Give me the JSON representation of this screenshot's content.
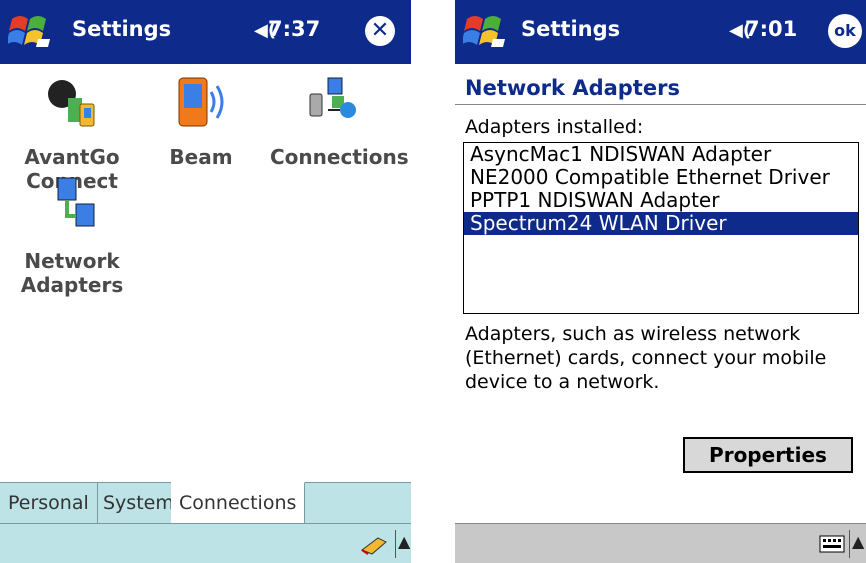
{
  "left": {
    "title": "Settings",
    "time": "7:37",
    "tiles": [
      {
        "label_l1": "AvantGo",
        "label_l2": "Connect"
      },
      {
        "label_l1": "Beam",
        "label_l2": ""
      },
      {
        "label_l1": "Connections",
        "label_l2": ""
      },
      {
        "label_l1": "Network",
        "label_l2": "Adapters"
      }
    ],
    "tabs": [
      "Personal",
      "System",
      "Connections"
    ],
    "active_tab": "Connections"
  },
  "right": {
    "title": "Settings",
    "time": "7:01",
    "ok_label": "ok",
    "page_title": "Network Adapters",
    "list_label": "Adapters installed:",
    "adapters": [
      "AsyncMac1 NDISWAN Adapter",
      "NE2000 Compatible Ethernet Driver",
      "PPTP1 NDISWAN Adapter",
      "Spectrum24 WLAN Driver"
    ],
    "selected_adapter": "Spectrum24 WLAN Driver",
    "description": "Adapters, such as wireless network (Ethernet) cards, connect your mobile device to a network.",
    "properties_label": "Properties"
  },
  "colors": {
    "titlebar": "#0e2a8a",
    "tabbar": "#bde3e6",
    "icon_label": "#4a4a4a"
  },
  "icons": [
    "windows-start-icon",
    "speaker-icon",
    "close-icon",
    "ok-icon",
    "avantgo-icon",
    "beam-icon",
    "connections-icon",
    "network-adapters-icon",
    "handwriting-input-icon",
    "keyboard-icon",
    "sip-arrow-up-icon"
  ]
}
